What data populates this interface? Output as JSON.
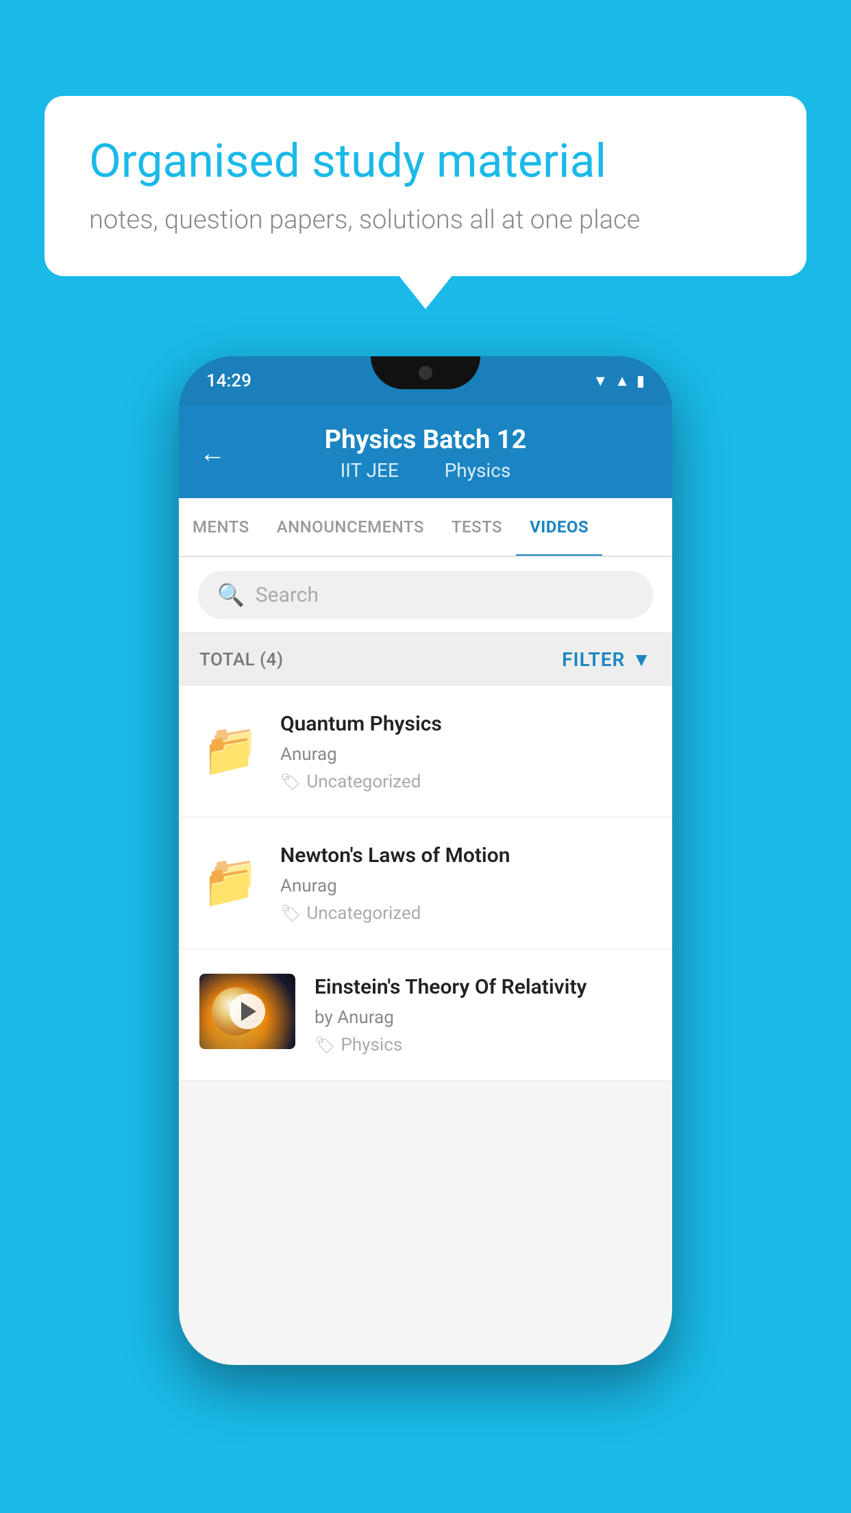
{
  "background_color": "#1ab9e8",
  "bubble": {
    "title": "Organised study material",
    "subtitle": "notes, question papers, solutions all at one place"
  },
  "phone": {
    "status_bar": {
      "time": "14:29"
    },
    "header": {
      "title": "Physics Batch 12",
      "subtitle_left": "IIT JEE",
      "subtitle_right": "Physics",
      "back_label": "←"
    },
    "tabs": [
      {
        "label": "MENTS",
        "active": false
      },
      {
        "label": "ANNOUNCEMENTS",
        "active": false
      },
      {
        "label": "TESTS",
        "active": false
      },
      {
        "label": "VIDEOS",
        "active": true
      }
    ],
    "search": {
      "placeholder": "Search"
    },
    "filter_bar": {
      "total_label": "TOTAL (4)",
      "filter_label": "FILTER"
    },
    "videos": [
      {
        "id": 1,
        "title": "Quantum Physics",
        "author": "Anurag",
        "tag": "Uncategorized",
        "type": "folder"
      },
      {
        "id": 2,
        "title": "Newton's Laws of Motion",
        "author": "Anurag",
        "tag": "Uncategorized",
        "type": "folder"
      },
      {
        "id": 3,
        "title": "Einstein's Theory Of Relativity",
        "author": "by Anurag",
        "tag": "Physics",
        "type": "video"
      }
    ]
  }
}
